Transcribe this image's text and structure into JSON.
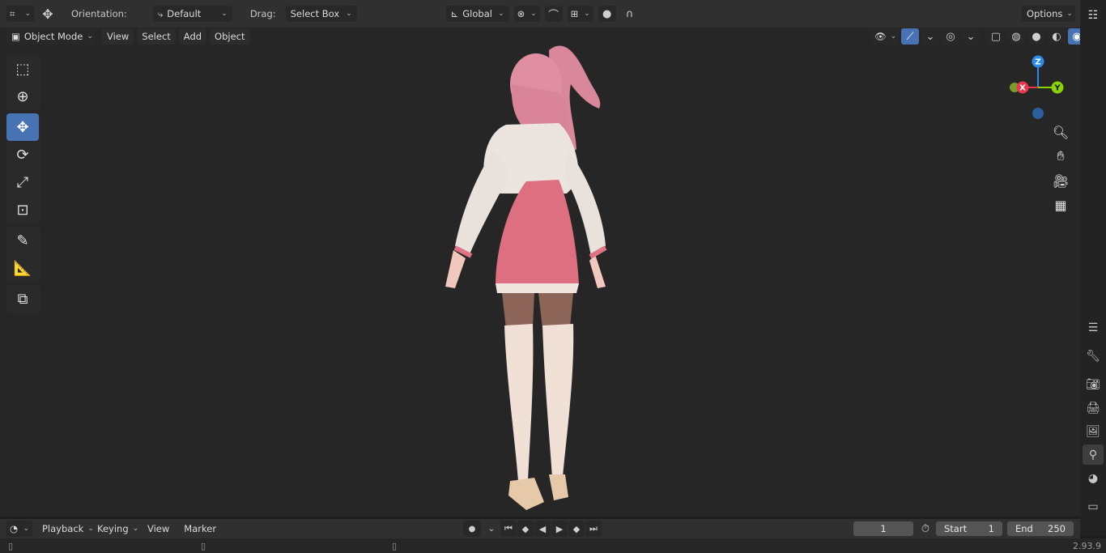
{
  "tool_header": {
    "orientation_label": "Orientation:",
    "orientation_value": "Default",
    "drag_label": "Drag:",
    "drag_value": "Select Box",
    "transform_orientation": "Global",
    "options_label": "Options"
  },
  "viewport_header": {
    "mode": "Object Mode",
    "menus": [
      "View",
      "Select",
      "Add",
      "Object"
    ]
  },
  "toolbar": {
    "tools": [
      "select-box",
      "cursor",
      "move",
      "rotate",
      "scale",
      "transform",
      "annotate",
      "measure",
      "add-cube"
    ],
    "active_tool": "move"
  },
  "gizmo": {
    "axis_x": "X",
    "axis_y": "Y",
    "axis_z": "Z"
  },
  "timeline": {
    "menus": [
      "Playback",
      "Keying",
      "View",
      "Marker"
    ],
    "current_frame": "1",
    "start_label": "Start",
    "start_value": "1",
    "end_label": "End",
    "end_value": "250"
  },
  "status": {
    "version": "2.93.9"
  },
  "colors": {
    "accent": "#4772b3",
    "axis_x": "#e8364e",
    "axis_y": "#8bd400",
    "axis_z": "#2d8ceb"
  }
}
